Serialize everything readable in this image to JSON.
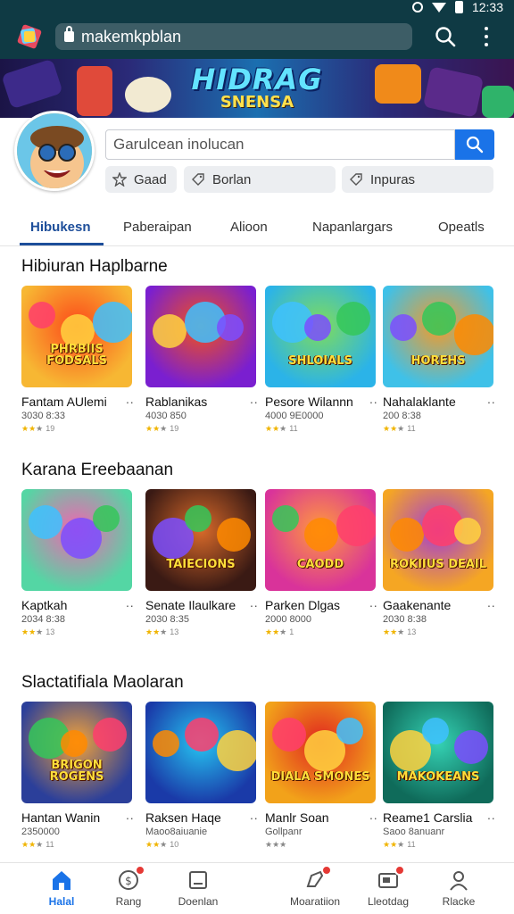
{
  "status": {
    "time": "12:33"
  },
  "browser": {
    "url": "makemkpblan"
  },
  "banner": {
    "title": "HIDRAG",
    "subtitle": "SNENSA"
  },
  "search": {
    "placeholder": "Garulcean inolucan"
  },
  "chips": [
    {
      "label": "Gaad",
      "icon": "star-icon"
    },
    {
      "label": "Borlan",
      "icon": "tag-icon"
    },
    {
      "label": "Inpuras",
      "icon": "tag-icon"
    }
  ],
  "tabs": [
    "Hibukesn",
    "Paberaipan",
    "Alioon",
    "Napanlargars",
    "Opeatls"
  ],
  "sections": [
    {
      "title": "Hibiuran Haplbarne",
      "cards": [
        {
          "name": "Fantam AUlemi",
          "meta": "3030 8:33",
          "rating": "19",
          "stars": 2,
          "art": "PHRBIIS FODSALS"
        },
        {
          "name": "Rablanikas",
          "meta": "4030 850",
          "rating": "19",
          "stars": 2,
          "art": ""
        },
        {
          "name": "Pesore Wilannn",
          "meta": "4000 9E0000",
          "rating": "11",
          "stars": 2,
          "art": "SHLOIALS"
        },
        {
          "name": "Nahalaklante",
          "meta": "200 8:38",
          "rating": "11",
          "stars": 2,
          "art": "HOREHS"
        }
      ]
    },
    {
      "title": "Karana Ereebaanan",
      "cards": [
        {
          "name": "Kaptkah",
          "meta": "2034 8:38",
          "rating": "13",
          "stars": 2,
          "art": ""
        },
        {
          "name": "Senate Ilaulkare",
          "meta": "2030 8:35",
          "rating": "13",
          "stars": 2,
          "art": "TAIECIONS"
        },
        {
          "name": "Parken Dlgas",
          "meta": "2000 8000",
          "rating": "1",
          "stars": 2,
          "art": "CAODD"
        },
        {
          "name": "Gaakenante",
          "meta": "2030 8:38",
          "rating": "13",
          "stars": 2,
          "art": "ROKIIUS DEAIL"
        }
      ]
    },
    {
      "title": "Slactatifiala Maolaran",
      "cards": [
        {
          "name": "Hantan Wanin",
          "meta": "2350000",
          "rating": "11",
          "stars": 2,
          "art": "BRIGON ROGENS"
        },
        {
          "name": "Raksen Haqe",
          "meta": "Maoo8aiuanie",
          "rating": "10",
          "stars": 2,
          "art": ""
        },
        {
          "name": "Manlr Soan",
          "meta": "Gollpanr",
          "rating": "",
          "stars": 0,
          "art": "DIALA SMONES"
        },
        {
          "name": "Reame1 Carslia",
          "meta": "Saoo 8anuanr",
          "rating": "11",
          "stars": 2,
          "art": "MAKOKEANS"
        }
      ]
    }
  ],
  "nav": [
    {
      "label": "Halal",
      "icon": "home-icon",
      "active": true,
      "badge": false
    },
    {
      "label": "Rang",
      "icon": "ranking-icon",
      "active": false,
      "badge": true
    },
    {
      "label": "Doenlan",
      "icon": "download-icon",
      "active": false,
      "badge": false
    },
    {
      "label": "Moaratiion",
      "icon": "notification-icon",
      "active": false,
      "badge": true
    },
    {
      "label": "Lleotdag",
      "icon": "inbox-icon",
      "active": false,
      "badge": true
    },
    {
      "label": "Rlacke",
      "icon": "profile-icon",
      "active": false,
      "badge": false
    }
  ],
  "colors": {
    "accent": "#1a73e8",
    "topbar": "#0f3a44",
    "tab_active": "#1d4e9a",
    "star": "#f0b400"
  }
}
